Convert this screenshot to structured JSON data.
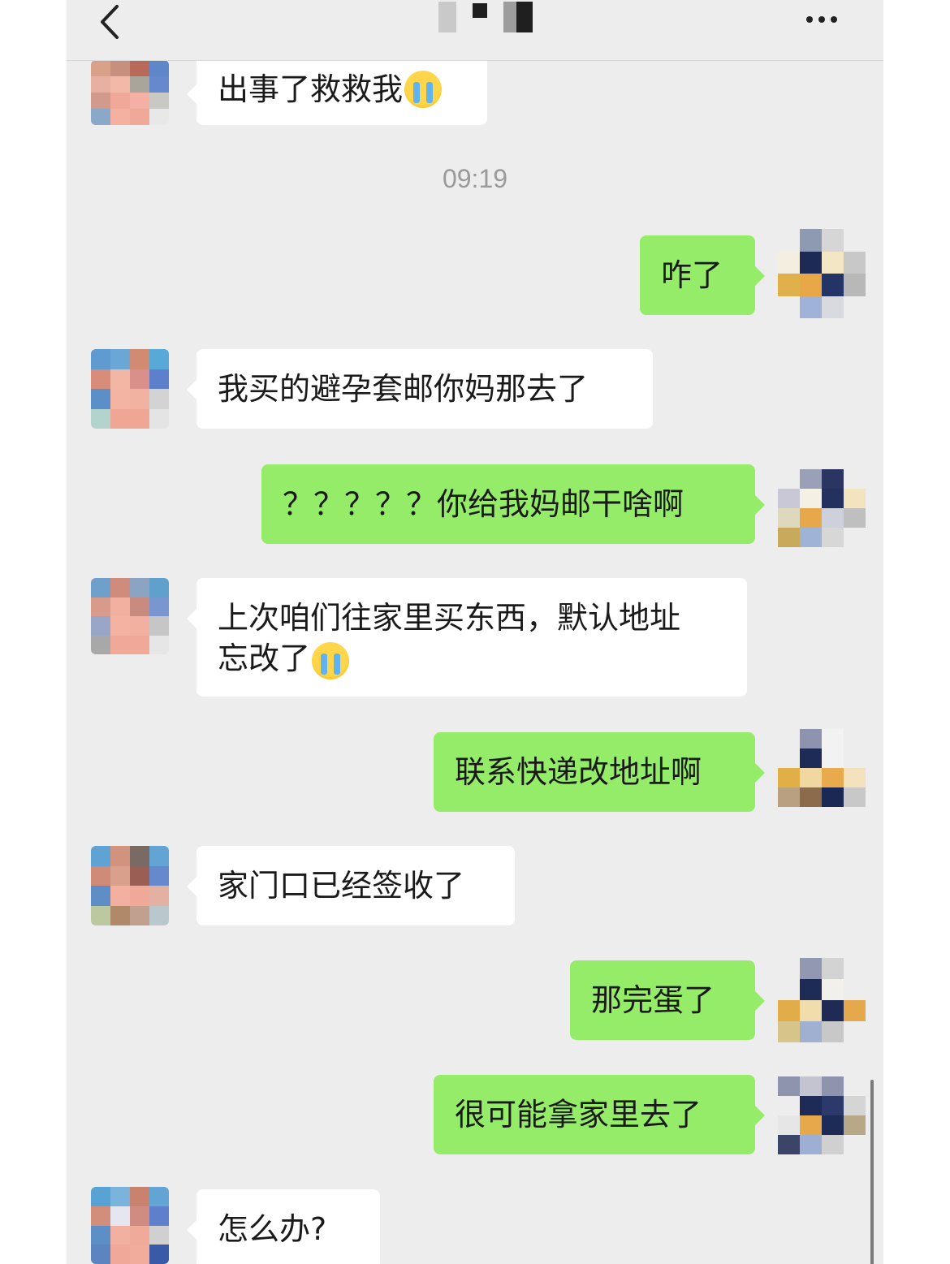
{
  "header": {
    "back_icon": "chevron-left-icon",
    "title": "■ ▪ ■",
    "more_icon": "more-dots-icon"
  },
  "messages": [
    {
      "side": "in",
      "text": "出事了救救我",
      "emoji": "crying-face-emoji"
    },
    {
      "side": "time",
      "text": "09:19"
    },
    {
      "side": "out",
      "text": "咋了"
    },
    {
      "side": "in",
      "text": "我买的避孕套邮你妈那去了"
    },
    {
      "side": "out",
      "text": "？？？？？你给我妈邮干啥啊"
    },
    {
      "side": "in",
      "text_line1": "上次咱们往家里买东西，默认地址",
      "text_line2": "忘改了",
      "emoji": "crying-face-emoji"
    },
    {
      "side": "out",
      "text": "联系快递改地址啊"
    },
    {
      "side": "in",
      "text": "家门口已经签收了"
    },
    {
      "side": "out",
      "text": "那完蛋了"
    },
    {
      "side": "out",
      "text": "很可能拿家里去了"
    },
    {
      "side": "in",
      "text": "怎么办?"
    }
  ],
  "colors": {
    "background": "#ededed",
    "incoming_bubble": "#ffffff",
    "outgoing_bubble": "#95ec69",
    "timestamp": "#9a9a9a"
  }
}
